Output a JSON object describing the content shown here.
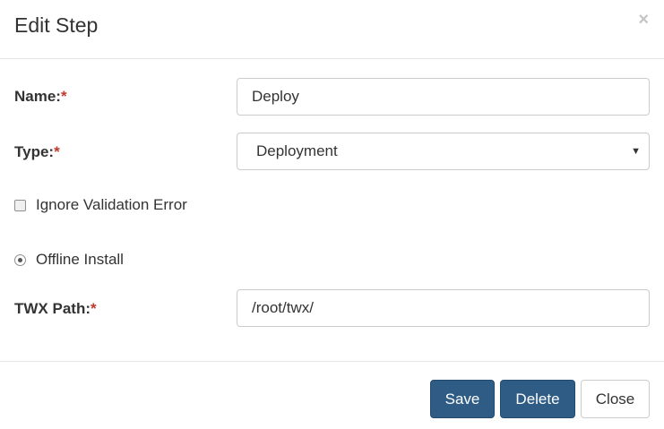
{
  "dialog": {
    "title": "Edit Step",
    "close_symbol": "×"
  },
  "form": {
    "name": {
      "label": "Name:",
      "required_mark": "*",
      "value": "Deploy"
    },
    "type": {
      "label": "Type:",
      "required_mark": "*",
      "selected": "Deployment",
      "caret": "▼"
    },
    "ignore_validation": {
      "label": "Ignore Validation Error",
      "checked": false
    },
    "offline_install": {
      "label": "Offline Install",
      "checked": true
    },
    "twx_path": {
      "label": "TWX Path:",
      "required_mark": "*",
      "value": "/root/twx/"
    }
  },
  "footer": {
    "save_label": "Save",
    "delete_label": "Delete",
    "close_label": "Close"
  },
  "colors": {
    "primary": "#2e5c85",
    "required": "#c0392b",
    "border": "#cccccc"
  }
}
